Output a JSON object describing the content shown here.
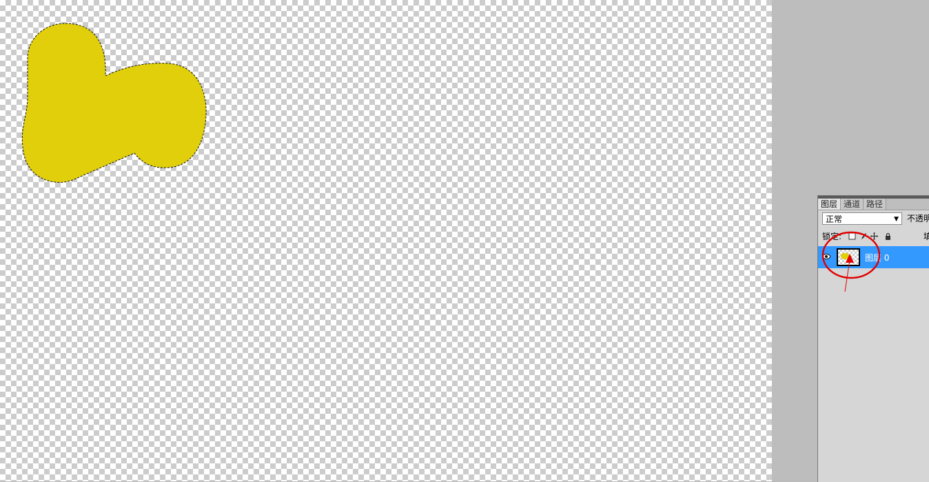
{
  "colors": {
    "shape_fill": "#e0cf0a",
    "selection_highlight": "#3399ff",
    "annotation_red": "#e00000"
  },
  "layers_panel": {
    "tabs": [
      {
        "label": "图层"
      },
      {
        "label": "通道"
      },
      {
        "label": "路径"
      }
    ],
    "blend_mode": "正常",
    "opacity_label": "不透明",
    "lock_label": "锁定:",
    "fill_label": "填",
    "layers": [
      {
        "name": "图层 0",
        "visible": true,
        "selected": true
      }
    ]
  },
  "icons": {
    "eye": "eye-icon",
    "lock_transparent": "lock-transparent-icon",
    "lock_paint": "brush-icon",
    "lock_move": "move-icon",
    "lock_all": "padlock-icon",
    "dropdown": "chevron-down-icon"
  }
}
